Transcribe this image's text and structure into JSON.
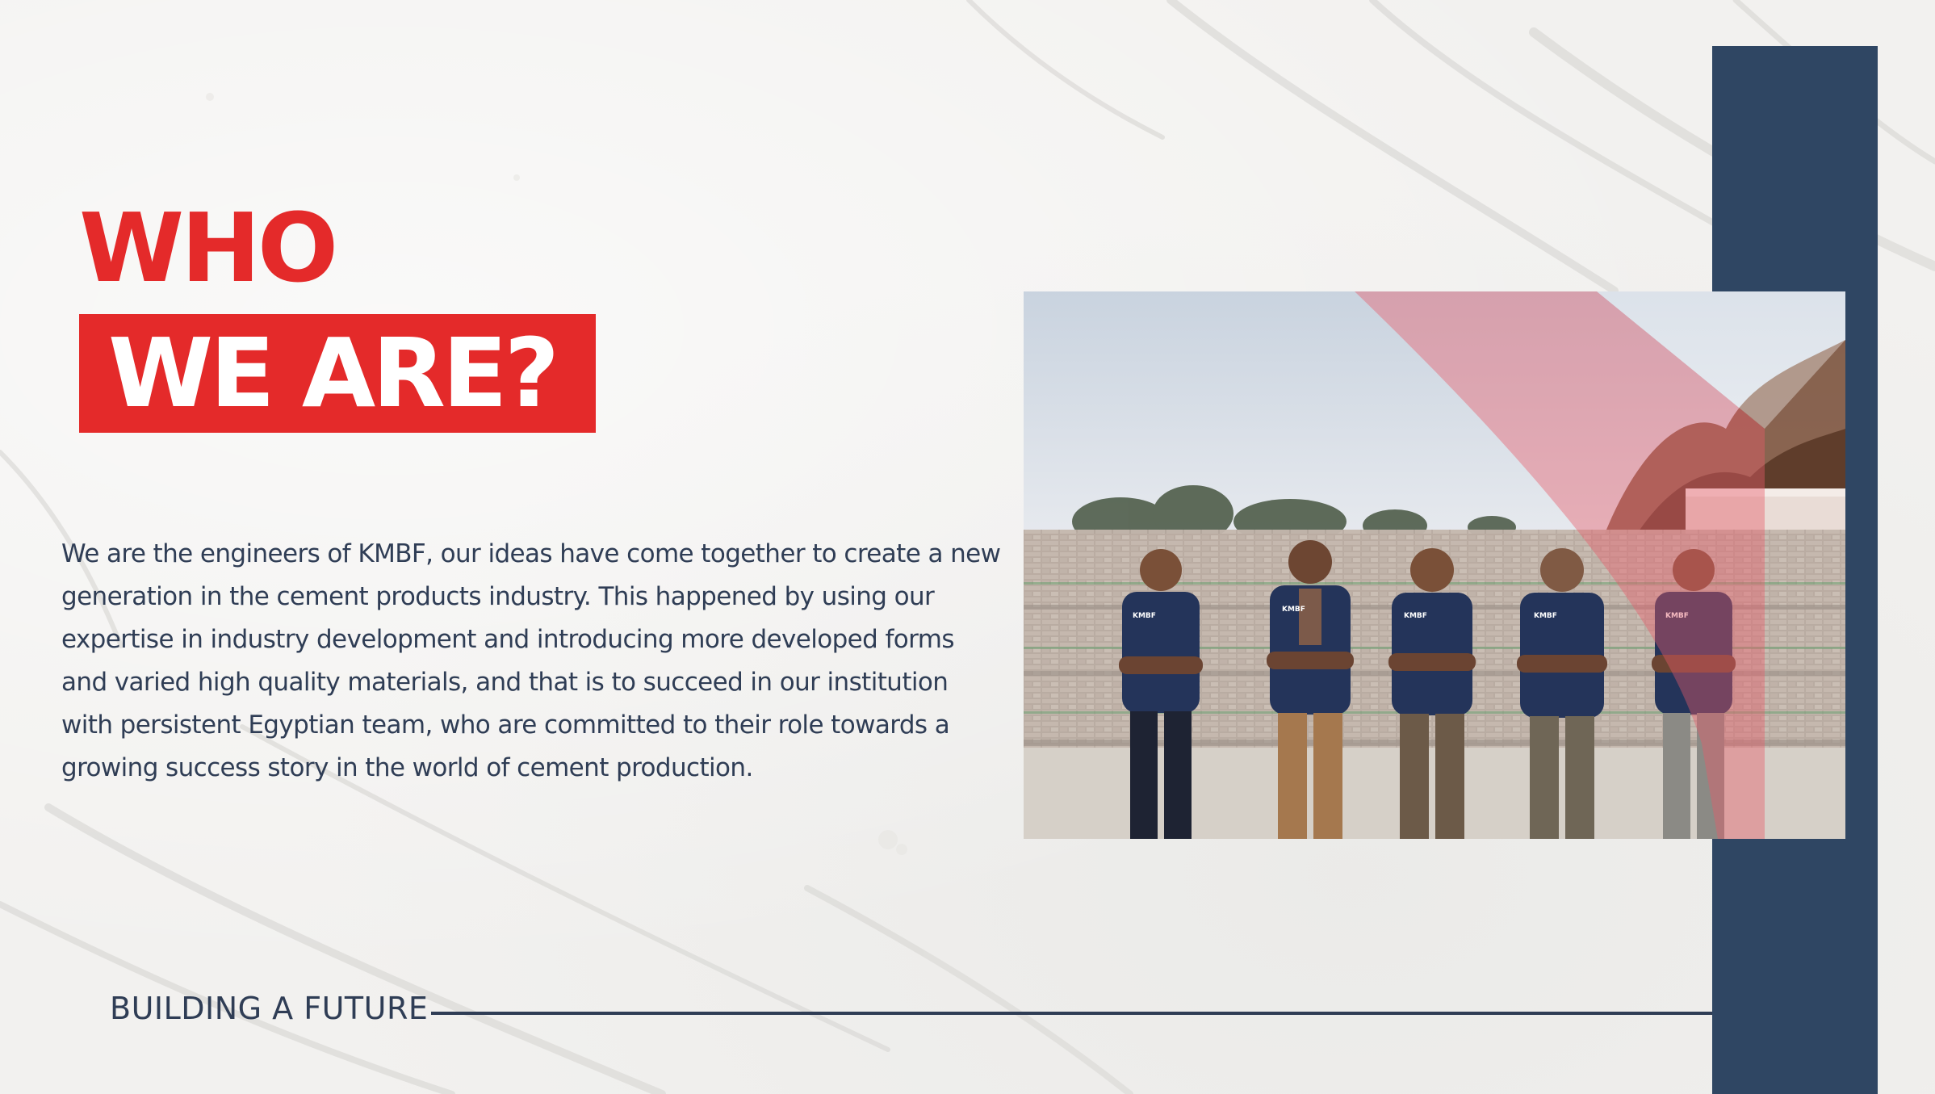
{
  "slide": {
    "title_line1": "WHO",
    "title_line2": "WE ARE?",
    "body": "We are the engineers of KMBF, our ideas have come together to create a new generation in the cement products industry. This happened by using our expertise in industry development and introducing more developed forms and varied high quality materials, and that is to succeed in our institution with persistent Egyptian team, who are committed to their role towards a growing success story in the world of cement production.",
    "footer_tagline": "BUILDING A FUTURE",
    "shirt_logo": "KMBF"
  },
  "colors": {
    "accent_red": "#e42a2a",
    "navy": "#2f4663",
    "text": "#2f3d55",
    "background": "#f2f1ef"
  }
}
